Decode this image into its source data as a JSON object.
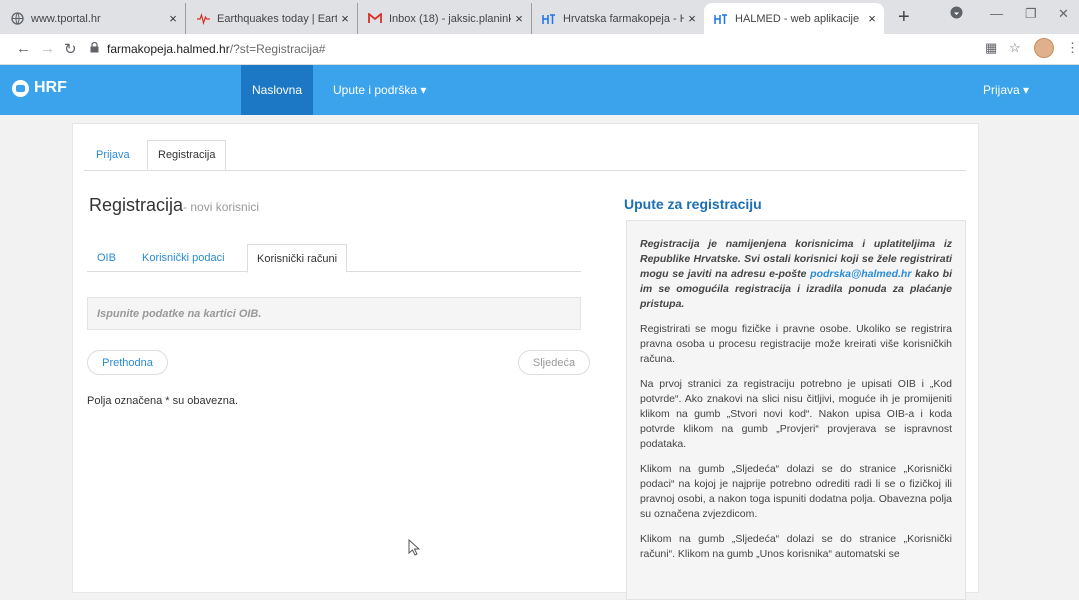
{
  "browser": {
    "tabs": [
      {
        "title": "www.tportal.hr",
        "icon": "globe-icon"
      },
      {
        "title": "Earthquakes today | Earth",
        "icon": "earthquake-icon"
      },
      {
        "title": "Inbox (18) - jaksic.planink",
        "icon": "gmail-icon"
      },
      {
        "title": "Hrvatska farmakopeja - H",
        "icon": "halmed-icon"
      },
      {
        "title": "HALMED - web aplikacije",
        "icon": "halmed-icon"
      }
    ],
    "new_tab": "+",
    "url_domain": "farmakopeja.halmed.hr",
    "url_path": "/?st=Registracija#"
  },
  "site": {
    "logo": "HRF",
    "nav": [
      "Naslovna",
      "Upute i podrška ▾"
    ],
    "login": "Prijava ▾"
  },
  "main": {
    "top_tabs": [
      "Prijava",
      "Registracija"
    ],
    "heading": "Registracija",
    "heading_sub": "- novi korisnici",
    "sub_tabs": [
      "OIB",
      "Korisnički podaci",
      "Korisnički računi"
    ],
    "notice": "Ispunite podatke na kartici OIB.",
    "prev_button": "Prethodna",
    "next_button": "Sljedeća",
    "required_note": "Polja označena * su obavezna."
  },
  "help": {
    "title": "Upute za registraciju",
    "intro_before": "Registracija je namijenjena korisnicima i uplatiteljima iz Republike Hrvatske. Svi ostali korisnici koji se žele registrirati mogu se javiti na adresu e-pošte ",
    "email": "podrska@halmed.hr",
    "intro_after": " kako bi im se omogućila registracija i izradila ponuda za plaćanje pristupa.",
    "p1": "Registrirati se mogu fizičke i pravne osobe. Ukoliko se registrira pravna osoba u procesu registracije može kreirati više korisničkih računa.",
    "p2": "Na prvoj stranici za registraciju potrebno je upisati OIB i „Kod potvrde“. Ako znakovi na slici nisu čitljivi, moguće ih je promijeniti klikom na gumb „Stvori novi kod“. Nakon upisa OIB-a i koda potvrde klikom na gumb „Provjeri“ provjerava se ispravnost podataka.",
    "p3": "Klikom na gumb „Sljedeća“ dolazi se do stranice „Korisnički podaci“ na kojoj je najprije potrebno odrediti radi li se o fizičkoj ili pravnoj osobi, a nakon toga ispuniti dodatna polja. Obavezna polja su označena zvjezdicom.",
    "p4": "Klikom na gumb „Sljedeća“ dolazi se do stranice „Korisnički računi“. Klikom na gumb „Unos korisnika“ automatski se"
  }
}
